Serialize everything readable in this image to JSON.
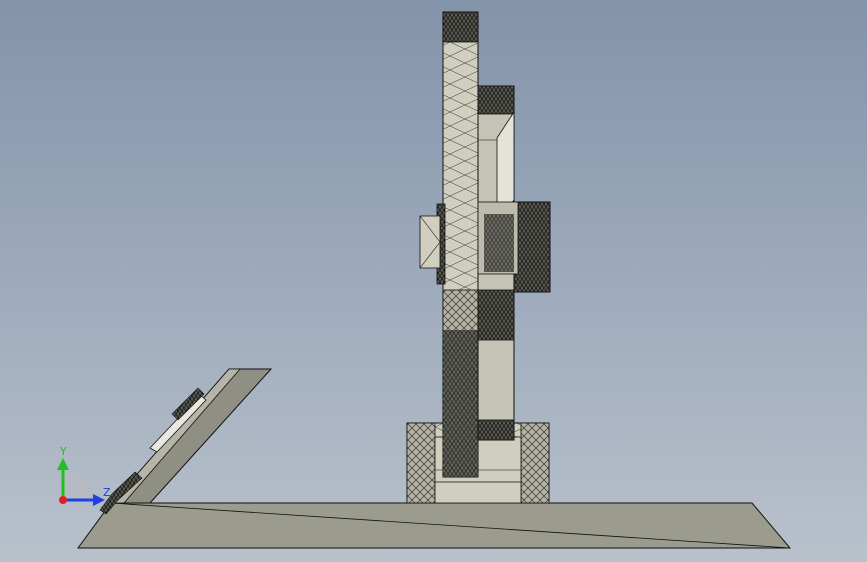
{
  "viewport": {
    "background_top": "#8393a9",
    "background_bottom": "#b9c1cb"
  },
  "colors": {
    "part_fill_light": "#cfcebf",
    "part_fill_mid": "#b2b1a2",
    "part_fill_dark": "#8d8d80",
    "base_plate": "#9b9b8e",
    "edge_lines": "#111111",
    "axis_x": "#e02020",
    "axis_y": "#20c020",
    "axis_z": "#2040e0"
  },
  "triad": {
    "x_label": "",
    "y_label": "Y",
    "z_label": "Z",
    "icon": "coordinate-triad-icon"
  }
}
